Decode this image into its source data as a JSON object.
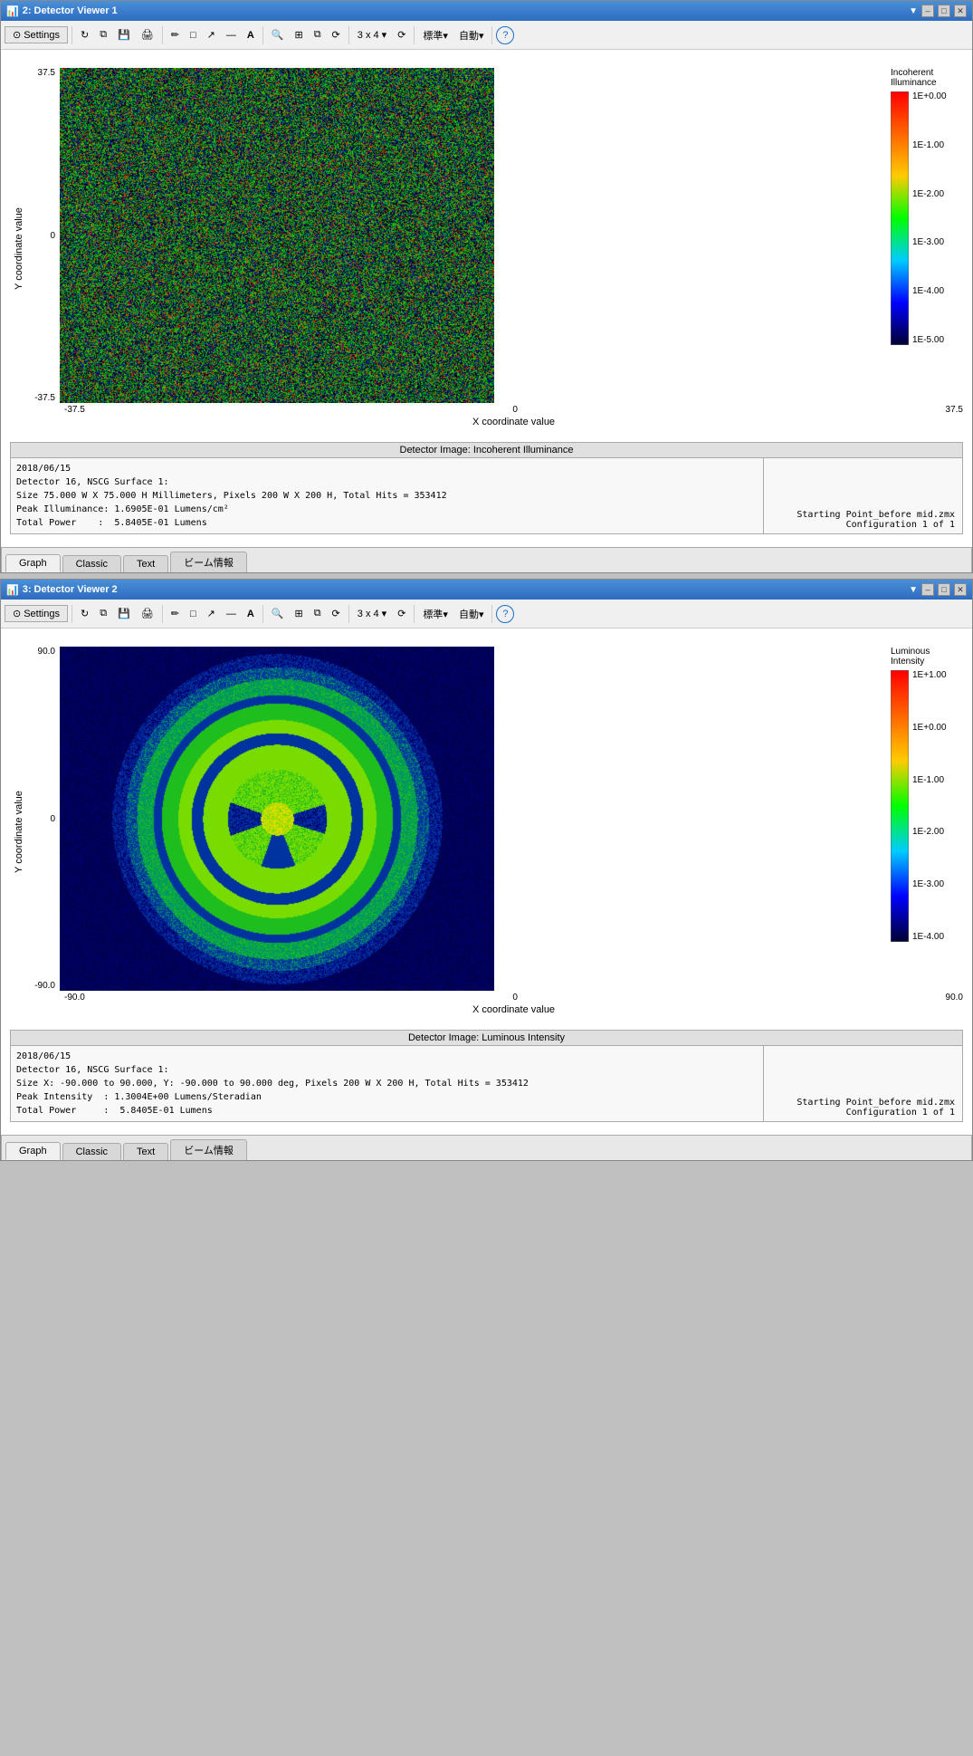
{
  "viewer1": {
    "title": "2: Detector Viewer 1",
    "settings_label": "Settings",
    "toolbar": {
      "items_3x4": "3 x 4 ▾",
      "standard": "標準▾",
      "auto": "自動▾"
    },
    "chart": {
      "y_max": "37.5",
      "y_mid": "0",
      "y_min": "-37.5",
      "x_min": "-37.5",
      "x_mid": "0",
      "x_max": "37.5",
      "x_label": "X coordinate value",
      "y_label": "Y coordinate value",
      "colorbar_title": "Incoherent\nIlluminance",
      "colorbar_labels": [
        "1E+0.00",
        "1E-1.00",
        "1E-2.00",
        "1E-3.00",
        "1E-4.00",
        "1E-5.00"
      ]
    },
    "info_header": "Detector Image: Incoherent Illuminance",
    "info_left": "2018/06/15\nDetector 16, NSCG Surface 1:\nSize 75.000 W X 75.000 H Millimeters, Pixels 200 W X 200 H, Total Hits = 353412\nPeak Illuminance: 1.6905E-01 Lumens/cm²\nTotal Power    :  5.8405E-01 Lumens",
    "info_right": "Starting Point_before mid.zmx\n   Configuration 1 of 1",
    "tabs": [
      "Graph",
      "Classic",
      "Text",
      "ビーム情報"
    ],
    "active_tab": "Graph"
  },
  "viewer2": {
    "title": "3: Detector Viewer 2",
    "settings_label": "Settings",
    "toolbar": {
      "items_3x4": "3 x 4 ▾",
      "standard": "標準▾",
      "auto": "自動▾"
    },
    "chart": {
      "y_max": "90.0",
      "y_mid": "0",
      "y_min": "-90.0",
      "x_min": "-90.0",
      "x_mid": "0",
      "x_max": "90.0",
      "x_label": "X coordinate value",
      "y_label": "Y coordinate value",
      "colorbar_title": "Luminous\nIntensity",
      "colorbar_labels": [
        "1E+1.00",
        "1E+0.00",
        "1E-1.00",
        "1E-2.00",
        "1E-3.00",
        "1E-4.00"
      ]
    },
    "info_header": "Detector Image: Luminous Intensity",
    "info_left": "2018/06/15\nDetector 16, NSCG Surface 1:\nSize X: -90.000 to 90.000, Y: -90.000 to 90.000 deg, Pixels 200 W X 200 H, Total Hits = 353412\nPeak Intensity  : 1.3004E+00 Lumens/Steradian\nTotal Power     :  5.8405E-01 Lumens",
    "info_right": "Starting Point_before mid.zmx\n   Configuration 1 of 1",
    "tabs": [
      "Graph",
      "Classic",
      "Text",
      "ビーム情報"
    ],
    "active_tab": "Graph"
  }
}
